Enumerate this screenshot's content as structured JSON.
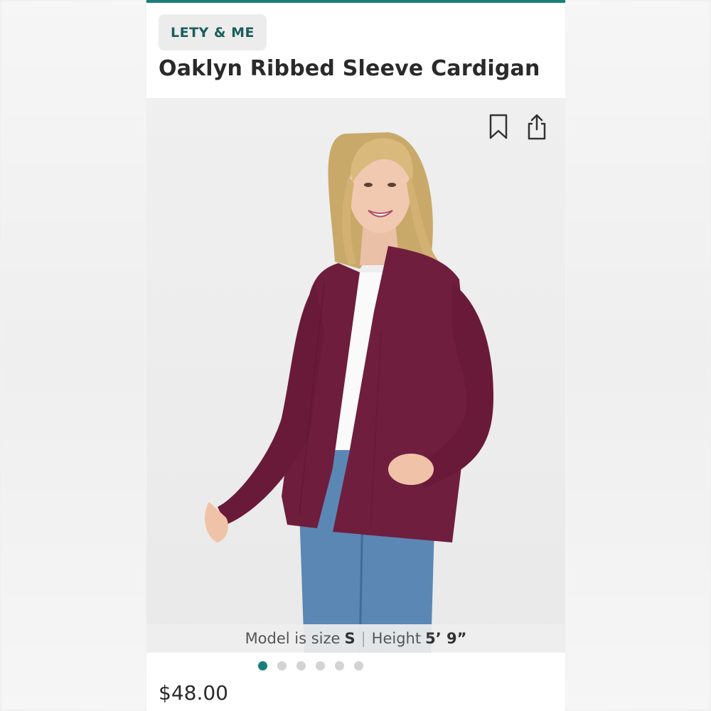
{
  "product": {
    "brand": "LETY & ME",
    "title": "Oaklyn Ribbed Sleeve Cardigan",
    "price": "$48.00"
  },
  "model_info": {
    "size_label": "Model is size",
    "size_value": "S",
    "separator": "|",
    "height_label": "Height",
    "height_value": "5’ 9”"
  },
  "carousel": {
    "total_images": 6,
    "active_index": 0
  },
  "icons": {
    "bookmark": "bookmark-icon",
    "share": "share-icon"
  },
  "colors": {
    "accent": "#1a7f79",
    "brand_text": "#1a5e5a",
    "cardigan": "#6e1d3c",
    "jeans": "#4f7fae"
  }
}
